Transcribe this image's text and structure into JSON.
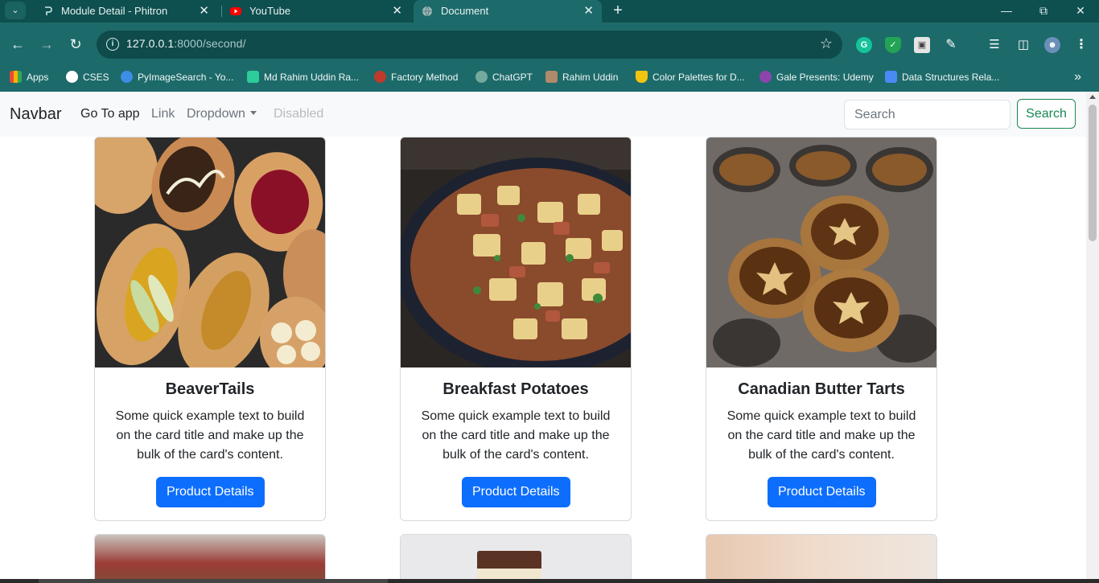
{
  "browser": {
    "tabs": [
      {
        "title": "Module Detail - Phitron",
        "icon": "phitron-icon"
      },
      {
        "title": "YouTube",
        "icon": "youtube-icon"
      },
      {
        "title": "Document",
        "icon": "globe-icon"
      }
    ],
    "url_host": "127.0.0.1",
    "url_path": ":8000/second/",
    "bookmarks": [
      {
        "label": "Apps",
        "icon": "apps-grid-icon",
        "color": "#e8a23a"
      },
      {
        "label": "CSES",
        "icon": "cses-icon",
        "color": "#ffffff"
      },
      {
        "label": "PyImageSearch - Yo...",
        "icon": "pyimagesearch-icon",
        "color": "#3d8ee6"
      },
      {
        "label": "Md Rahim Uddin Ra...",
        "icon": "leetcode-icon",
        "color": "#2ecc9a"
      },
      {
        "label": "Factory Method",
        "icon": "refactoring-icon",
        "color": "#c0392b"
      },
      {
        "label": "ChatGPT",
        "icon": "chatgpt-icon",
        "color": "#74aa9c"
      },
      {
        "label": "Rahim Uddin",
        "icon": "profile-photo-icon",
        "color": "#b08a6a"
      },
      {
        "label": "Color Palettes for D...",
        "icon": "palette-icon",
        "color": "#f1c40f"
      },
      {
        "label": "Gale Presents: Udemy",
        "icon": "udemy-icon",
        "color": "#8e44ad"
      },
      {
        "label": "Data Structures Rela...",
        "icon": "docs-icon",
        "color": "#4a8af4"
      }
    ]
  },
  "navbar": {
    "brand": "Navbar",
    "links": [
      "Go To app",
      "Link",
      "Dropdown",
      "Disabled"
    ],
    "search_placeholder": "Search",
    "search_button": "Search"
  },
  "cards": [
    {
      "title": "BeaverTails",
      "text": "Some quick example text to build on the card title and make up the bulk of the card's content.",
      "button": "Product Details",
      "image": "beavertails-photo"
    },
    {
      "title": "Breakfast Potatoes",
      "text": "Some quick example text to build on the card title and make up the bulk of the card's content.",
      "button": "Product Details",
      "image": "breakfast-potatoes-photo"
    },
    {
      "title": "Canadian Butter Tarts",
      "text": "Some quick example text to build on the card title and make up the bulk of the card's content.",
      "button": "Product Details",
      "image": "butter-tarts-photo"
    }
  ],
  "colors": {
    "chrome": "#1d6a6a",
    "primary_button": "#0d6efd",
    "success_outline": "#198754"
  }
}
